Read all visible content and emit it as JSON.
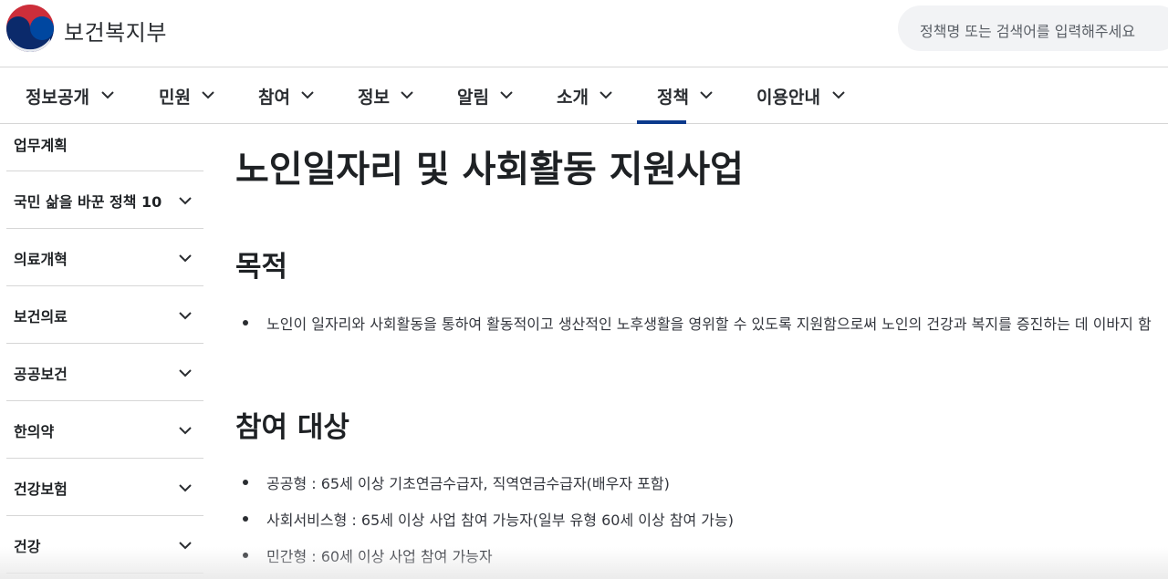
{
  "header": {
    "brand": "보건복지부",
    "search_placeholder": "정책명 또는 검색어를 입력해주세요"
  },
  "nav": {
    "items": [
      {
        "label": "정보공개"
      },
      {
        "label": "민원"
      },
      {
        "label": "참여"
      },
      {
        "label": "정보"
      },
      {
        "label": "알림"
      },
      {
        "label": "소개"
      },
      {
        "label": "정책"
      },
      {
        "label": "이용안내"
      }
    ],
    "active": "정책"
  },
  "sidebar": {
    "items": [
      {
        "label": "업무계획"
      },
      {
        "label": "국민 삶을 바꾼 정책 10"
      },
      {
        "label": "의료개혁"
      },
      {
        "label": "보건의료"
      },
      {
        "label": "공공보건"
      },
      {
        "label": "한의약"
      },
      {
        "label": "건강보험"
      },
      {
        "label": "건강"
      }
    ]
  },
  "main": {
    "title": "노인일자리 및 사회활동 지원사업",
    "purpose": {
      "heading": "목적",
      "items": [
        "노인이 일자리와 사회활동을 통하여 활동적이고 생산적인 노후생활을 영위할 수 있도록 지원함으로써 노인의 건강과 복지를 증진하는 데 이바지 함"
      ]
    },
    "eligibility": {
      "heading": "참여 대상",
      "items": [
        "공공형 : 65세 이상 기초연금수급자, 직역연금수급자(배우자 포함)",
        "사회서비스형 : 65세 이상 사업 참여 가능자(일부 유형 60세 이상 참여 가능)",
        "민간형 : 60세 이상 사업 참여 가능자"
      ]
    }
  },
  "colors": {
    "accent": "#0b3a8c",
    "logo_red": "#cd2e3a",
    "logo_blue": "#0047a0"
  }
}
